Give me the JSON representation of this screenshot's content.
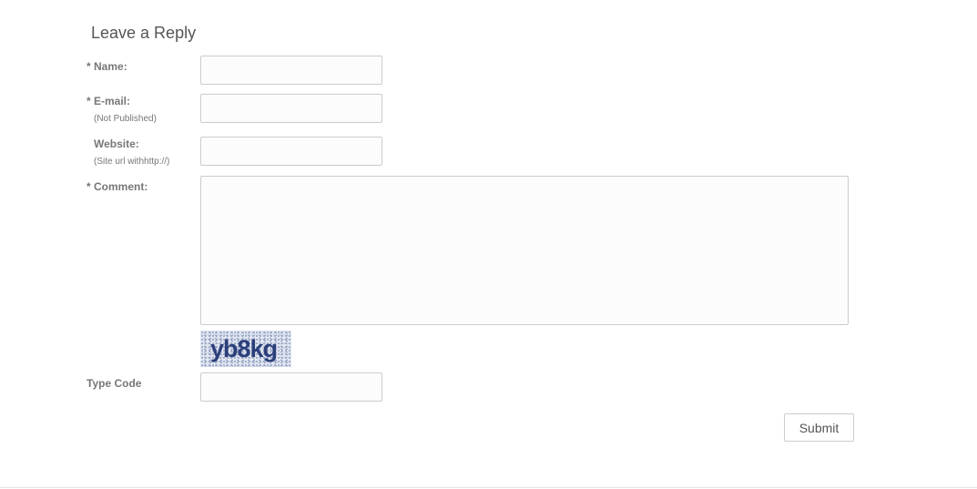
{
  "form": {
    "title": "Leave a Reply",
    "name_label": "* Name:",
    "email_label": "* E-mail:",
    "email_note": "(Not Published)",
    "website_label": "Website:",
    "website_note": "(Site url withhttp://)",
    "comment_label": "* Comment:",
    "captcha_text": "yb8kg",
    "type_code_label": "Type Code",
    "submit_label": "Submit",
    "name_value": "",
    "email_value": "",
    "website_value": "",
    "comment_value": "",
    "code_value": ""
  }
}
